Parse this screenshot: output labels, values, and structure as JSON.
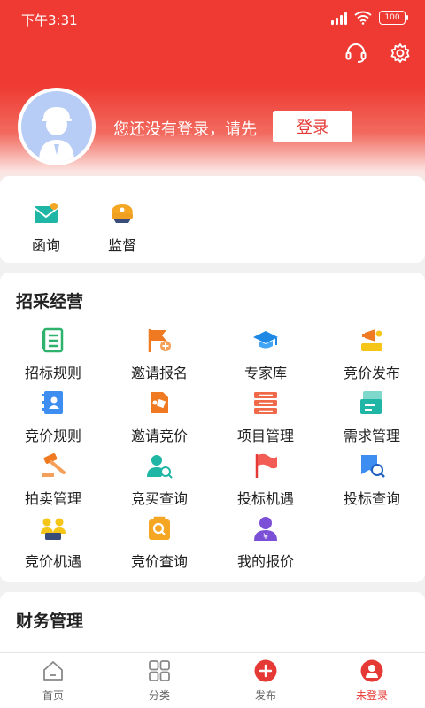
{
  "status_bar": {
    "time": "下午3:31",
    "battery": "100"
  },
  "profile": {
    "login_hint": "您还没有登录，请先",
    "login_button": "登录"
  },
  "quick_links": [
    {
      "label": "函询",
      "icon": "mail-icon"
    },
    {
      "label": "监督",
      "icon": "police-cap-icon"
    }
  ],
  "procurement": {
    "title": "招采经营",
    "items": [
      {
        "label": "招标规则",
        "icon": "clipboard-list-icon"
      },
      {
        "label": "邀请报名",
        "icon": "flag-plus-icon"
      },
      {
        "label": "专家库",
        "icon": "graduation-cap-icon"
      },
      {
        "label": "竞价发布",
        "icon": "megaphone-icon"
      },
      {
        "label": "竞价规则",
        "icon": "notebook-icon"
      },
      {
        "label": "邀请竞价",
        "icon": "document-tag-icon"
      },
      {
        "label": "项目管理",
        "icon": "stack-list-icon"
      },
      {
        "label": "需求管理",
        "icon": "card-stack-icon"
      },
      {
        "label": "拍卖管理",
        "icon": "gavel-icon"
      },
      {
        "label": "竞买查询",
        "icon": "user-search-icon"
      },
      {
        "label": "投标机遇",
        "icon": "red-flag-icon"
      },
      {
        "label": "投标查询",
        "icon": "flag-search-icon"
      },
      {
        "label": "竞价机遇",
        "icon": "group-icon"
      },
      {
        "label": "竞价查询",
        "icon": "bag-search-icon"
      },
      {
        "label": "我的报价",
        "icon": "user-yen-icon"
      }
    ]
  },
  "finance": {
    "title": "财务管理"
  },
  "tabbar": [
    {
      "label": "首页",
      "icon": "home-icon",
      "active": false
    },
    {
      "label": "分类",
      "icon": "grid-icon",
      "active": false
    },
    {
      "label": "发布",
      "icon": "plus-circle-icon",
      "active": false
    },
    {
      "label": "未登录",
      "icon": "user-circle-icon",
      "active": true
    }
  ],
  "colors": {
    "brand": "#ee3a32",
    "active_tab": "#e53935",
    "avatar_bg": "#b8cdf6"
  }
}
